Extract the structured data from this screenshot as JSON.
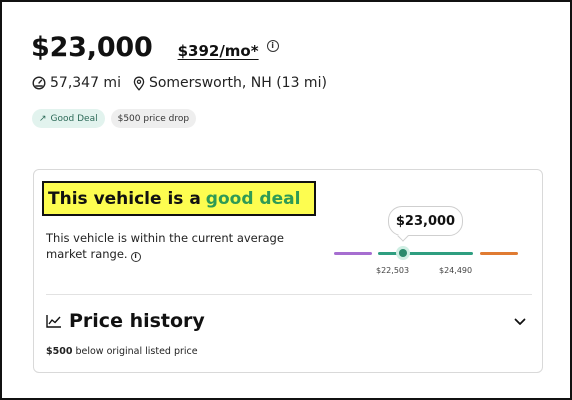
{
  "listing": {
    "price": "$23,000",
    "monthly_payment": "$392/mo*",
    "mileage": "57,347 mi",
    "location": "Somersworth, NH (13 mi)",
    "tags": {
      "good_deal": "Good Deal",
      "price_drop": "$500 price drop"
    }
  },
  "deal": {
    "headline_prefix": "This vehicle is a",
    "headline_highlight": "good deal",
    "description": "This vehicle is within the current average market range.",
    "price_marker": "$23,000",
    "range_low": "$22,503",
    "range_high": "$24,490"
  },
  "history": {
    "title": "Price history",
    "drop_amount": "$500",
    "drop_text": "below original listed price"
  },
  "colors": {
    "good_green": "#2e9a55",
    "below_market": "#a66ed0",
    "in_market": "#2e9e80",
    "above_market": "#e07b32",
    "highlight_yellow": "#fdfd50"
  }
}
